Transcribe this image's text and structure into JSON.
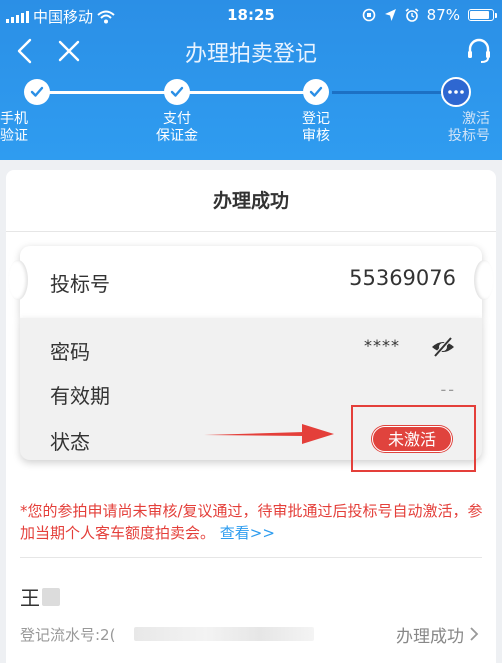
{
  "status_bar": {
    "carrier": "中国移动",
    "time": "18:25",
    "battery": "87%"
  },
  "nav": {
    "title": "办理拍卖登记"
  },
  "steps": [
    {
      "label_line1": "手机",
      "label_line2": "验证",
      "state": "done"
    },
    {
      "label_line1": "支付",
      "label_line2": "保证金",
      "state": "done"
    },
    {
      "label_line1": "登记",
      "label_line2": "审核",
      "state": "done"
    },
    {
      "label_line1": "激活",
      "label_line2": "投标号",
      "state": "current"
    }
  ],
  "card": {
    "title": "办理成功",
    "bid_number_label": "投标号",
    "bid_number_value": "55369076",
    "password_label": "密码",
    "password_value": "****",
    "validity_label": "有效期",
    "validity_value": "--",
    "status_label": "状态",
    "status_value": "未激活",
    "notice_text": "*您的参拍申请尚未审核/复议通过，待审批通过后投标号自动激活，参加当期个人客车额度拍卖会。",
    "notice_link": "查看>>",
    "user_name": "王",
    "reg_label": "登记流水号:2(",
    "reg_status": "办理成功"
  },
  "colors": {
    "header_blue": "#2f9cf0",
    "status_red": "#e0433d",
    "link_blue": "#2d9cef"
  }
}
